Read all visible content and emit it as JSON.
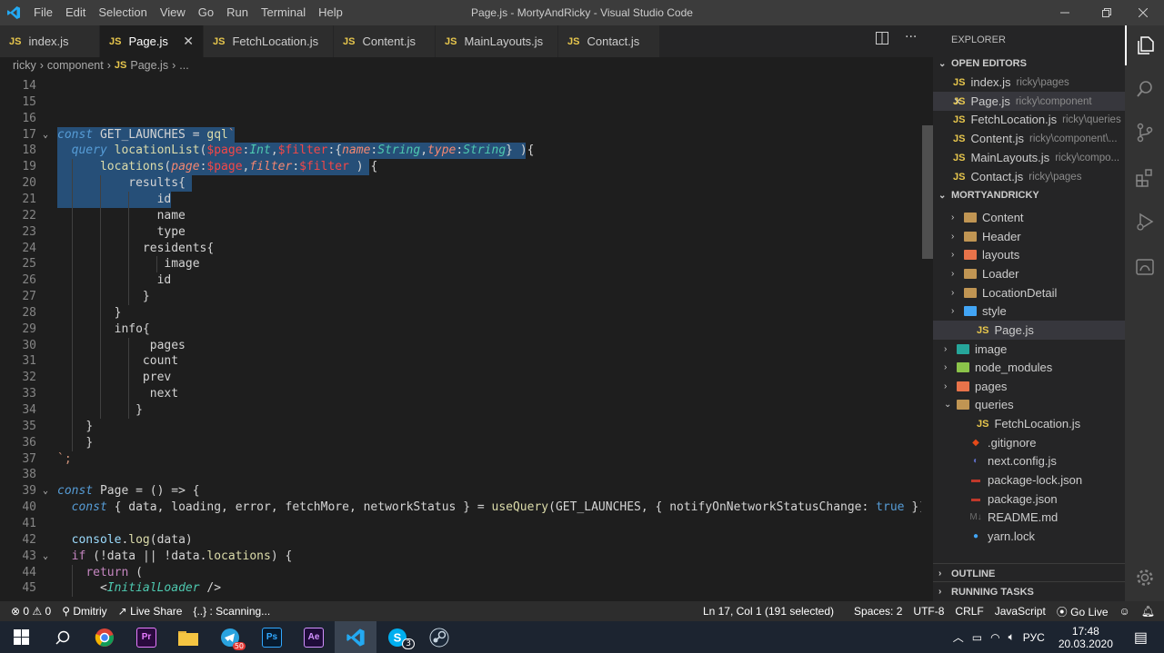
{
  "titlebar": {
    "title": "Page.js - MortyAndRicky - Visual Studio Code",
    "menu": [
      "File",
      "Edit",
      "Selection",
      "View",
      "Go",
      "Run",
      "Terminal",
      "Help"
    ],
    "accent": "#007acc"
  },
  "tabs": [
    {
      "label": "index.js",
      "active": false
    },
    {
      "label": "Page.js",
      "active": true
    },
    {
      "label": "FetchLocation.js",
      "active": false
    },
    {
      "label": "Content.js",
      "active": false
    },
    {
      "label": "MainLayouts.js",
      "active": false
    },
    {
      "label": "Contact.js",
      "active": false
    }
  ],
  "breadcrumb": {
    "parts": [
      "ricky",
      "component"
    ],
    "file": "Page.js",
    "more": "..."
  },
  "editor": {
    "lines": [
      {
        "n": "14",
        "text": ""
      },
      {
        "n": "15",
        "text": ""
      },
      {
        "n": "16",
        "text": ""
      },
      {
        "n": "17",
        "text": "const GET_LAUNCHES = gql`"
      },
      {
        "n": "18",
        "text": "  query locationList($page:Int,$filter:{name:String,type:String} ){"
      },
      {
        "n": "19",
        "text": "      locations(page:$page,filter:$filter ) {"
      },
      {
        "n": "20",
        "text": "          results{"
      },
      {
        "n": "21",
        "text": "              id"
      },
      {
        "n": "22",
        "text": "              name"
      },
      {
        "n": "23",
        "text": "              type"
      },
      {
        "n": "24",
        "text": "            residents{"
      },
      {
        "n": "25",
        "text": "               image"
      },
      {
        "n": "26",
        "text": "              id"
      },
      {
        "n": "27",
        "text": "            }"
      },
      {
        "n": "28",
        "text": "        }"
      },
      {
        "n": "29",
        "text": "        info{"
      },
      {
        "n": "30",
        "text": "             pages"
      },
      {
        "n": "31",
        "text": "            count"
      },
      {
        "n": "32",
        "text": "            prev"
      },
      {
        "n": "33",
        "text": "             next"
      },
      {
        "n": "34",
        "text": "           }"
      },
      {
        "n": "35",
        "text": "    }"
      },
      {
        "n": "36",
        "text": "    }"
      },
      {
        "n": "37",
        "text": "`;"
      },
      {
        "n": "38",
        "text": ""
      },
      {
        "n": "39",
        "text": "const Page = () => {"
      },
      {
        "n": "40",
        "text": "  const { data, loading, error, fetchMore, networkStatus } = useQuery(GET_LAUNCHES, { notifyOnNetworkStatusChange: true });"
      },
      {
        "n": "41",
        "text": ""
      },
      {
        "n": "42",
        "text": "  console.log(data)"
      },
      {
        "n": "43",
        "text": "  if (!data || !data.locations) {"
      },
      {
        "n": "44",
        "text": "    return ("
      },
      {
        "n": "45",
        "text": "      <InitialLoader />"
      }
    ]
  },
  "explorer": {
    "title": "EXPLORER",
    "open_editors_label": "OPEN EDITORS",
    "open_editors": [
      {
        "name": "index.js",
        "desc": "ricky\\pages"
      },
      {
        "name": "Page.js",
        "desc": "ricky\\component",
        "active": true
      },
      {
        "name": "FetchLocation.js",
        "desc": "ricky\\queries"
      },
      {
        "name": "Content.js",
        "desc": "ricky\\component\\..."
      },
      {
        "name": "MainLayouts.js",
        "desc": "ricky\\compo..."
      },
      {
        "name": "Contact.js",
        "desc": "ricky\\pages"
      }
    ],
    "project_label": "MORTYANDRICKY",
    "tree": [
      {
        "name": "Content",
        "kind": "folder"
      },
      {
        "name": "Header",
        "kind": "folder"
      },
      {
        "name": "layouts",
        "kind": "folder"
      },
      {
        "name": "Loader",
        "kind": "folder"
      },
      {
        "name": "LocationDetail",
        "kind": "folder"
      },
      {
        "name": "style",
        "kind": "folder"
      },
      {
        "name": "Page.js",
        "kind": "js"
      },
      {
        "name": "image",
        "kind": "folder"
      },
      {
        "name": "node_modules",
        "kind": "folder"
      },
      {
        "name": "pages",
        "kind": "folder"
      },
      {
        "name": "queries",
        "kind": "folder"
      },
      {
        "name": "FetchLocation.js",
        "kind": "js"
      },
      {
        "name": ".gitignore",
        "kind": "file"
      },
      {
        "name": "next.config.js",
        "kind": "file"
      },
      {
        "name": "package-lock.json",
        "kind": "file"
      },
      {
        "name": "package.json",
        "kind": "file"
      },
      {
        "name": "README.md",
        "kind": "file"
      },
      {
        "name": "yarn.lock",
        "kind": "file"
      }
    ],
    "outline_label": "OUTLINE",
    "tasks_label": "RUNNING TASKS"
  },
  "statusbar": {
    "errors": "0",
    "warnings": "0",
    "user": "Dmitriy",
    "live_share": "Live Share",
    "scanning": "{..} : Scanning...",
    "position": "Ln 17, Col 1 (191 selected)",
    "spaces": "Spaces: 2",
    "encoding": "UTF-8",
    "eol": "CRLF",
    "language": "JavaScript",
    "golive": "Go Live"
  },
  "taskbar": {
    "lang": "РУС",
    "time": "17:48",
    "date": "20.03.2020",
    "telegram_badge": "50",
    "skype_badge": "3"
  }
}
